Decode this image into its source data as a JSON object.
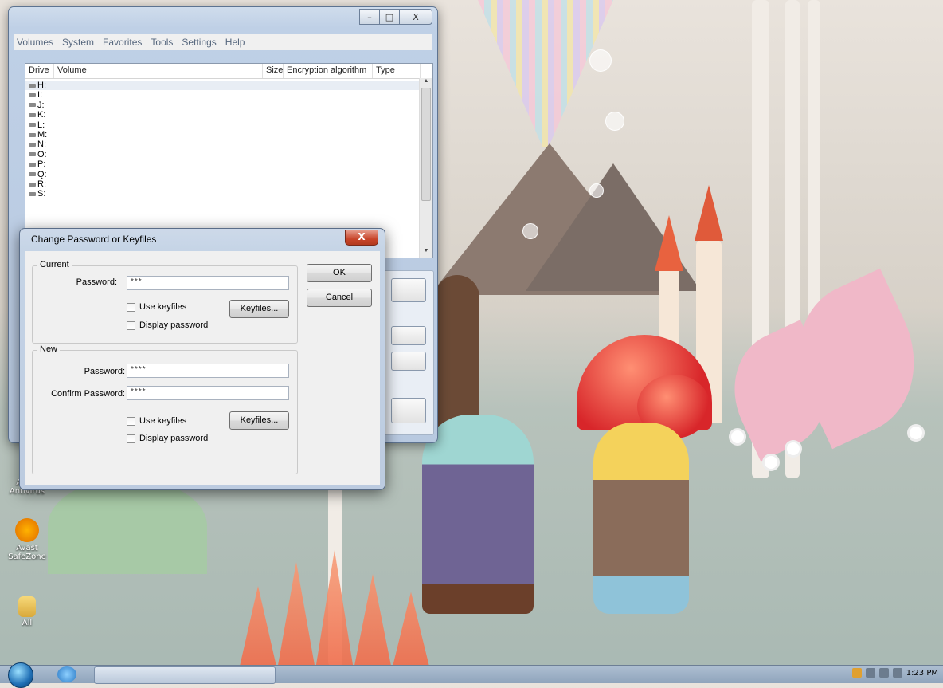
{
  "main_window": {
    "menu": [
      "Volumes",
      "System",
      "Favorites",
      "Tools",
      "Settings",
      "Help"
    ],
    "columns": [
      "Drive",
      "Volume",
      "Size",
      "Encryption algorithm",
      "Type"
    ],
    "drives": [
      "H:",
      "I:",
      "J:",
      "K:",
      "L:",
      "M:",
      "N:",
      "O:",
      "P:",
      "Q:",
      "R:",
      "S:"
    ],
    "selected_drive": "H:",
    "caption": {
      "minimize": "–",
      "maximize": "□",
      "close": "X"
    }
  },
  "dialog": {
    "title": "Change Password or Keyfiles",
    "close_glyph": "X",
    "current": {
      "group_label": "Current",
      "password_label": "Password:",
      "password_value": "***",
      "use_keyfiles_label": "Use keyfiles",
      "keyfiles_button": "Keyfiles...",
      "display_password_label": "Display password"
    },
    "new": {
      "group_label": "New",
      "password_label": "Password:",
      "password_value": "****",
      "confirm_label": "Confirm Password:",
      "confirm_value": "****",
      "use_keyfiles_label": "Use keyfiles",
      "keyfiles_button": "Keyfiles...",
      "display_password_label": "Display password"
    },
    "ok_button": "OK",
    "cancel_button": "Cancel"
  },
  "desktop_icons": [
    {
      "label": "Avast Antivirus",
      "icon": "avast-icon"
    },
    {
      "label": "Avast SafeZone",
      "icon": "avast-safezone-icon"
    },
    {
      "label": "All",
      "icon": "folder-icon"
    }
  ],
  "taskbar": {
    "time": "1:23 PM"
  },
  "colors": {
    "window_frame": "#bfd0e6",
    "dialog_close": "#c8452a",
    "taskbar": "#9fb2c8"
  }
}
